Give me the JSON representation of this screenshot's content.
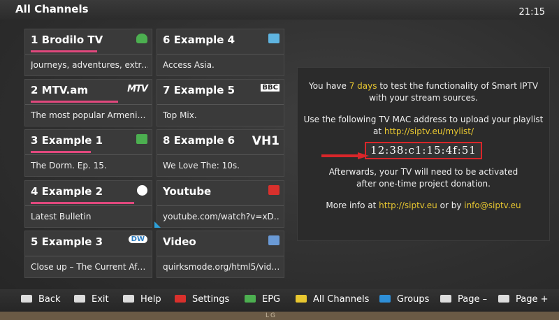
{
  "header": {
    "title": "All Channels",
    "time": "21:15"
  },
  "channels": [
    {
      "name": "1  Brodilo TV",
      "desc": "Journeys, adventures, extr…",
      "logo": "frog-icon",
      "logo_color": "#4caf50",
      "progress": 0.6
    },
    {
      "name": "6  Example 4",
      "desc": "Access Asia.",
      "logo": "asia-icon",
      "logo_color": "#5fb4e0",
      "progress": 0
    },
    {
      "name": "2  MTV.am",
      "desc": "The most popular Armeni…",
      "logo_text": "MTV",
      "logo_color": "#ffffff",
      "progress": 0.66
    },
    {
      "name": "7  Example 5",
      "desc": "Top Mix.",
      "logo_text": "BBC",
      "logo_color": "#ffffff",
      "progress": 0
    },
    {
      "name": "3  Example 1",
      "desc": "The Dorm. Ep. 15.",
      "logo": "mtv-icon",
      "logo_color": "#4caf50",
      "progress": 0.48
    },
    {
      "name": "8  Example 6",
      "desc": "We Love The: 10s.",
      "logo_text": "VH1",
      "logo_color": "#ffffff",
      "progress": 0
    },
    {
      "name": "4  Example 2",
      "desc": "Latest Bulletin",
      "logo": "circle-icon",
      "logo_color": "#ffffff",
      "progress": 0.9
    },
    {
      "name": "Youtube",
      "desc": "youtube.com/watch?v=xD…",
      "logo": "youtube-icon",
      "logo_color": "#d9302c",
      "progress": 0
    },
    {
      "name": "5  Example 3",
      "desc": "Close up – The Current Af…",
      "logo_text": "DW",
      "logo_color": "#2e7ec2",
      "progress": 0
    },
    {
      "name": "Video",
      "desc": "quirksmode.org/html5/vid…",
      "logo": "video-icon",
      "logo_color": "#6a9ad6",
      "progress": 0
    }
  ],
  "info": {
    "line1_pre": "You have ",
    "line1_days": "7 days",
    "line1_post": " to test the functionality of Smart IPTV",
    "line2": "with your stream sources.",
    "line3": "Use the following TV MAC address to upload your playlist",
    "line4_pre": "at ",
    "line4_link": "http://siptv.eu/mylist/",
    "mac": "12:38:c1:15:4f:51",
    "line5": "Afterwards, your TV will need to be activated",
    "line6": "after one-time project donation.",
    "line7_pre": "More info at ",
    "line7_link": "http://siptv.eu",
    "line7_mid": " or by ",
    "line7_email": "info@siptv.eu"
  },
  "bottom": {
    "back": "Back",
    "exit": "Exit",
    "help": "Help",
    "settings": "Settings",
    "epg": "EPG",
    "all_channels": "All Channels",
    "groups": "Groups",
    "page_down": "Page –",
    "page_up": "Page +"
  },
  "brand": "LG",
  "colors": {
    "accent_pink": "#e0487d",
    "highlight_yellow": "#e8c730",
    "mac_border": "#d8262a",
    "red_key": "#d9302c",
    "green_key": "#4caf50",
    "yellow_key": "#e8c730",
    "blue_key": "#2e8fd8"
  }
}
